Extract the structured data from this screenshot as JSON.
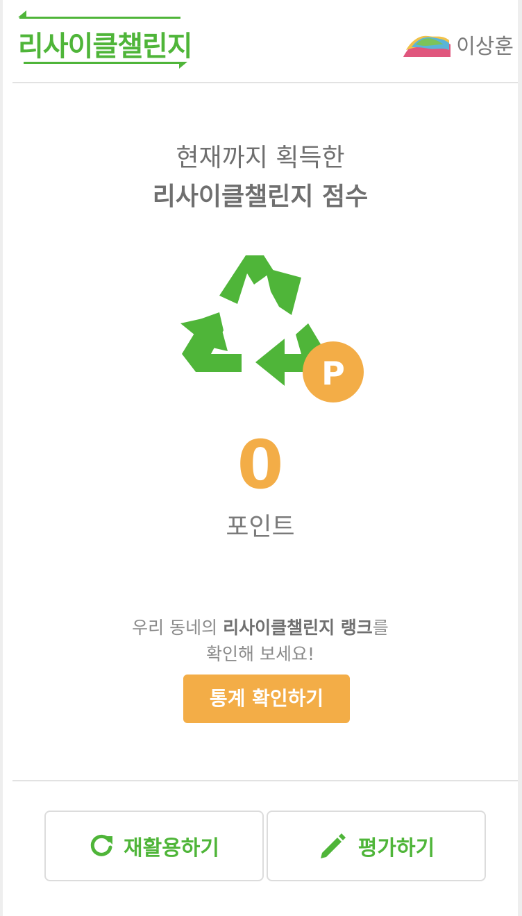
{
  "header": {
    "logo_text": "리사이클챌린지",
    "user_name": "이상훈"
  },
  "score": {
    "subtitle": "현재까지 획득한",
    "title": "리사이클챌린지 점수",
    "points_badge": "P",
    "value": "0",
    "unit": "포인트"
  },
  "rank": {
    "line1_prefix": "우리 동네의 ",
    "line1_bold": "리사이클챌린지 랭크",
    "line1_suffix": "를",
    "line2": "확인해 보세요!",
    "button_label": "통계 확인하기"
  },
  "actions": {
    "recycle_label": "재활용하기",
    "review_label": "평가하기"
  },
  "colors": {
    "brand_green": "#4fb539",
    "accent_orange": "#f3ad47",
    "text_gray": "#6f6f6f"
  },
  "icons": {
    "recycle": "recycle-icon",
    "points_badge": "points-badge-icon",
    "refresh": "refresh-icon",
    "pencil": "pencil-icon",
    "avatar": "avatar-icon"
  }
}
